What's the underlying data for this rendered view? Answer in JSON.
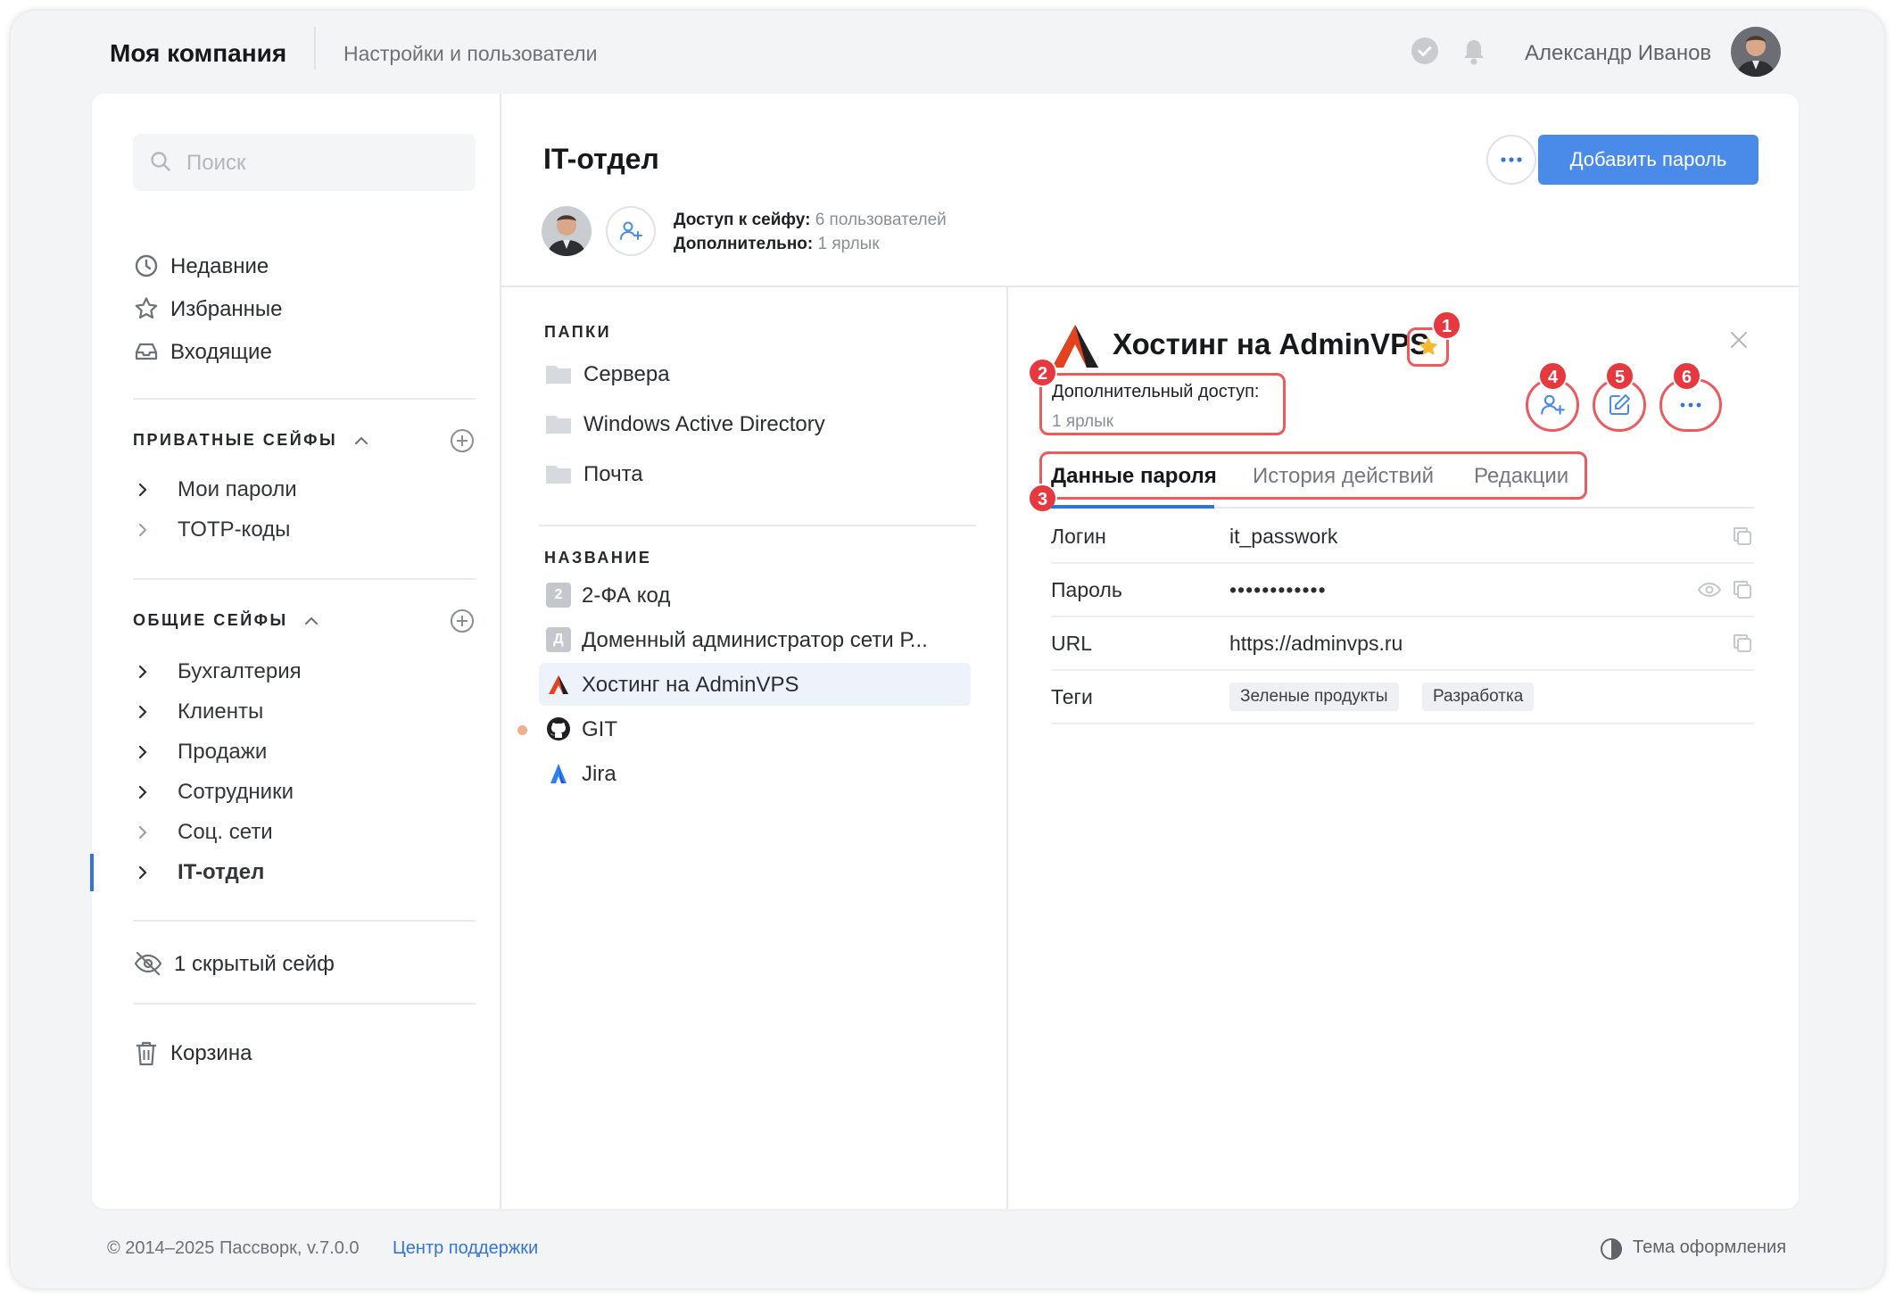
{
  "header": {
    "company": "Моя компания",
    "subtitle": "Настройки и пользователи",
    "user_name": "Александр Иванов"
  },
  "sidebar": {
    "search_placeholder": "Поиск",
    "quick": [
      {
        "label": "Недавние",
        "icon": "clock-icon"
      },
      {
        "label": "Избранные",
        "icon": "star-icon"
      },
      {
        "label": "Входящие",
        "icon": "inbox-icon"
      }
    ],
    "private_title": "ПРИВАТНЫЕ СЕЙФЫ",
    "private_items": [
      "Мои пароли",
      "TOTP-коды"
    ],
    "shared_title": "ОБЩИЕ СЕЙФЫ",
    "shared_items": [
      "Бухгалтерия",
      "Клиенты",
      "Продажи",
      "Сотрудники",
      "Соц. сети",
      "IT-отдел"
    ],
    "active_item": "IT-отдел",
    "hidden": "1 скрытый сейф",
    "trash": "Корзина"
  },
  "safe": {
    "title": "IT-отдел",
    "access_label": "Доступ к сейфу:",
    "access_value": "6 пользователей",
    "extra_label": "Дополнительно:",
    "extra_value": "1 ярлык",
    "add_button": "Добавить пароль"
  },
  "list": {
    "folders_title": "ПАПКИ",
    "folders": [
      "Сервера",
      "Windows Active Directory",
      "Почта"
    ],
    "names_title": "НАЗВАНИЕ",
    "items": [
      {
        "label": "2-ФА код",
        "icon": "letter-2-icon",
        "letter": "2"
      },
      {
        "label": "Доменный администратор сети Р...",
        "icon": "letter-d-icon",
        "letter": "Д"
      },
      {
        "label": "Хостинг на AdminVPS",
        "icon": "adminvps-logo-icon",
        "selected": true
      },
      {
        "label": "GIT",
        "icon": "github-icon"
      },
      {
        "label": "Jira",
        "icon": "jira-icon"
      }
    ]
  },
  "detail": {
    "title": "Хостинг на AdminVPS",
    "extra_access_label": "Дополнительный доступ:",
    "extra_access_value": "1 ярлык",
    "tabs": [
      "Данные пароля",
      "История действий",
      "Редакции"
    ],
    "fields": [
      {
        "key": "Логин",
        "value": "it_passwork"
      },
      {
        "key": "Пароль",
        "value": "••••••••••••"
      },
      {
        "key": "URL",
        "value": "https://adminvps.ru"
      }
    ],
    "tags_label": "Теги",
    "tags": [
      "Зеленые продукты",
      "Разработка"
    ],
    "markers": [
      "1",
      "2",
      "3",
      "4",
      "5",
      "6"
    ],
    "accent": "#e5393f"
  },
  "footer": {
    "copyright": "© 2014–2025 Пассворк, v.7.0.0",
    "support": "Центр поддержки",
    "theme": "Тема оформления"
  },
  "colors": {
    "primary": "#4a8ae8",
    "active": "#3573d9",
    "star": "#f5b82e"
  }
}
